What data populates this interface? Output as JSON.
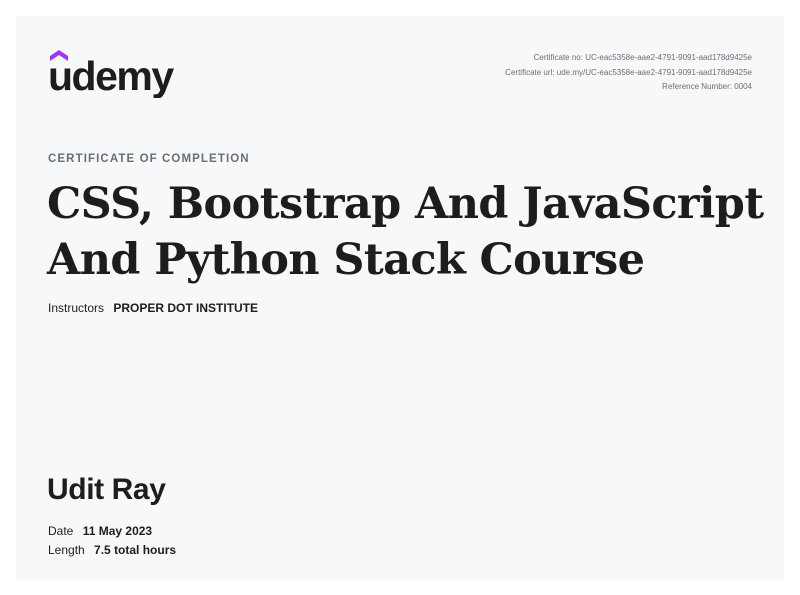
{
  "brand": {
    "logo_text": "udemy",
    "accent_color": "#a435f0",
    "text_color": "#1c1d1f"
  },
  "meta": {
    "certificate_no": "Certificate no: UC-eac5358e-aae2-4791-9091-aad178d9425e",
    "certificate_url": "Certificate url: ude.my/UC-eac5358e-aae2-4791-9091-aad178d9425e",
    "reference_number": "Reference Number: 0004"
  },
  "certificate": {
    "kicker": "CERTIFICATE OF COMPLETION",
    "course_title_line1": "CSS, Bootstrap And JavaScript",
    "course_title_line2": "And Python Stack Course",
    "instructors_label": "Instructors",
    "instructors_value": "PROPER DOT INSTITUTE",
    "student_name": "Udit Ray",
    "date_label": "Date",
    "date_value": "11 May 2023",
    "length_label": "Length",
    "length_value": "7.5 total hours"
  }
}
